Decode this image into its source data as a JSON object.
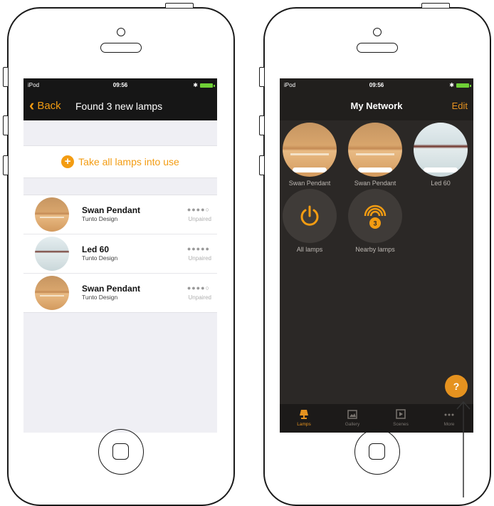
{
  "left_screen": {
    "status": {
      "carrier": "iPod",
      "time": "09:56",
      "bluetooth": "✱"
    },
    "nav": {
      "back_label": "Back",
      "title": "Found 3 new lamps"
    },
    "take_all_label": "Take all lamps into use",
    "lamps": [
      {
        "name": "Swan Pendant",
        "maker": "Tunto Design",
        "signal": "●●●●○",
        "status": "Unpaired",
        "thumb": "pendant"
      },
      {
        "name": "Led 60",
        "maker": "Tunto Design",
        "signal": "●●●●●",
        "status": "Unpaired",
        "thumb": "led"
      },
      {
        "name": "Swan Pendant",
        "maker": "Tunto Design",
        "signal": "●●●●○",
        "status": "Unpaired",
        "thumb": "pendant"
      }
    ]
  },
  "right_screen": {
    "status": {
      "carrier": "iPod",
      "time": "09:56",
      "bluetooth": "✱"
    },
    "nav": {
      "title": "My Network",
      "edit_label": "Edit"
    },
    "lamps": [
      {
        "name": "Swan Pendant"
      },
      {
        "name": "Swan Pendant"
      },
      {
        "name": "Led 60"
      }
    ],
    "groups": [
      {
        "label": "All lamps",
        "icon": "power-icon"
      },
      {
        "label": "Nearby lamps",
        "icon": "wifi-signal-icon",
        "badge": "3"
      }
    ],
    "help_label": "?",
    "tabs": [
      {
        "label": "Lamps",
        "icon": "lamp-icon",
        "active": true
      },
      {
        "label": "Gallery",
        "icon": "gallery-icon",
        "active": false
      },
      {
        "label": "Scenes",
        "icon": "scenes-icon",
        "active": false
      },
      {
        "label": "More",
        "icon": "more-icon",
        "active": false
      }
    ]
  },
  "colors": {
    "accent": "#f39c12",
    "dark_bg": "#2b2826",
    "light_bg": "#efeff4"
  }
}
